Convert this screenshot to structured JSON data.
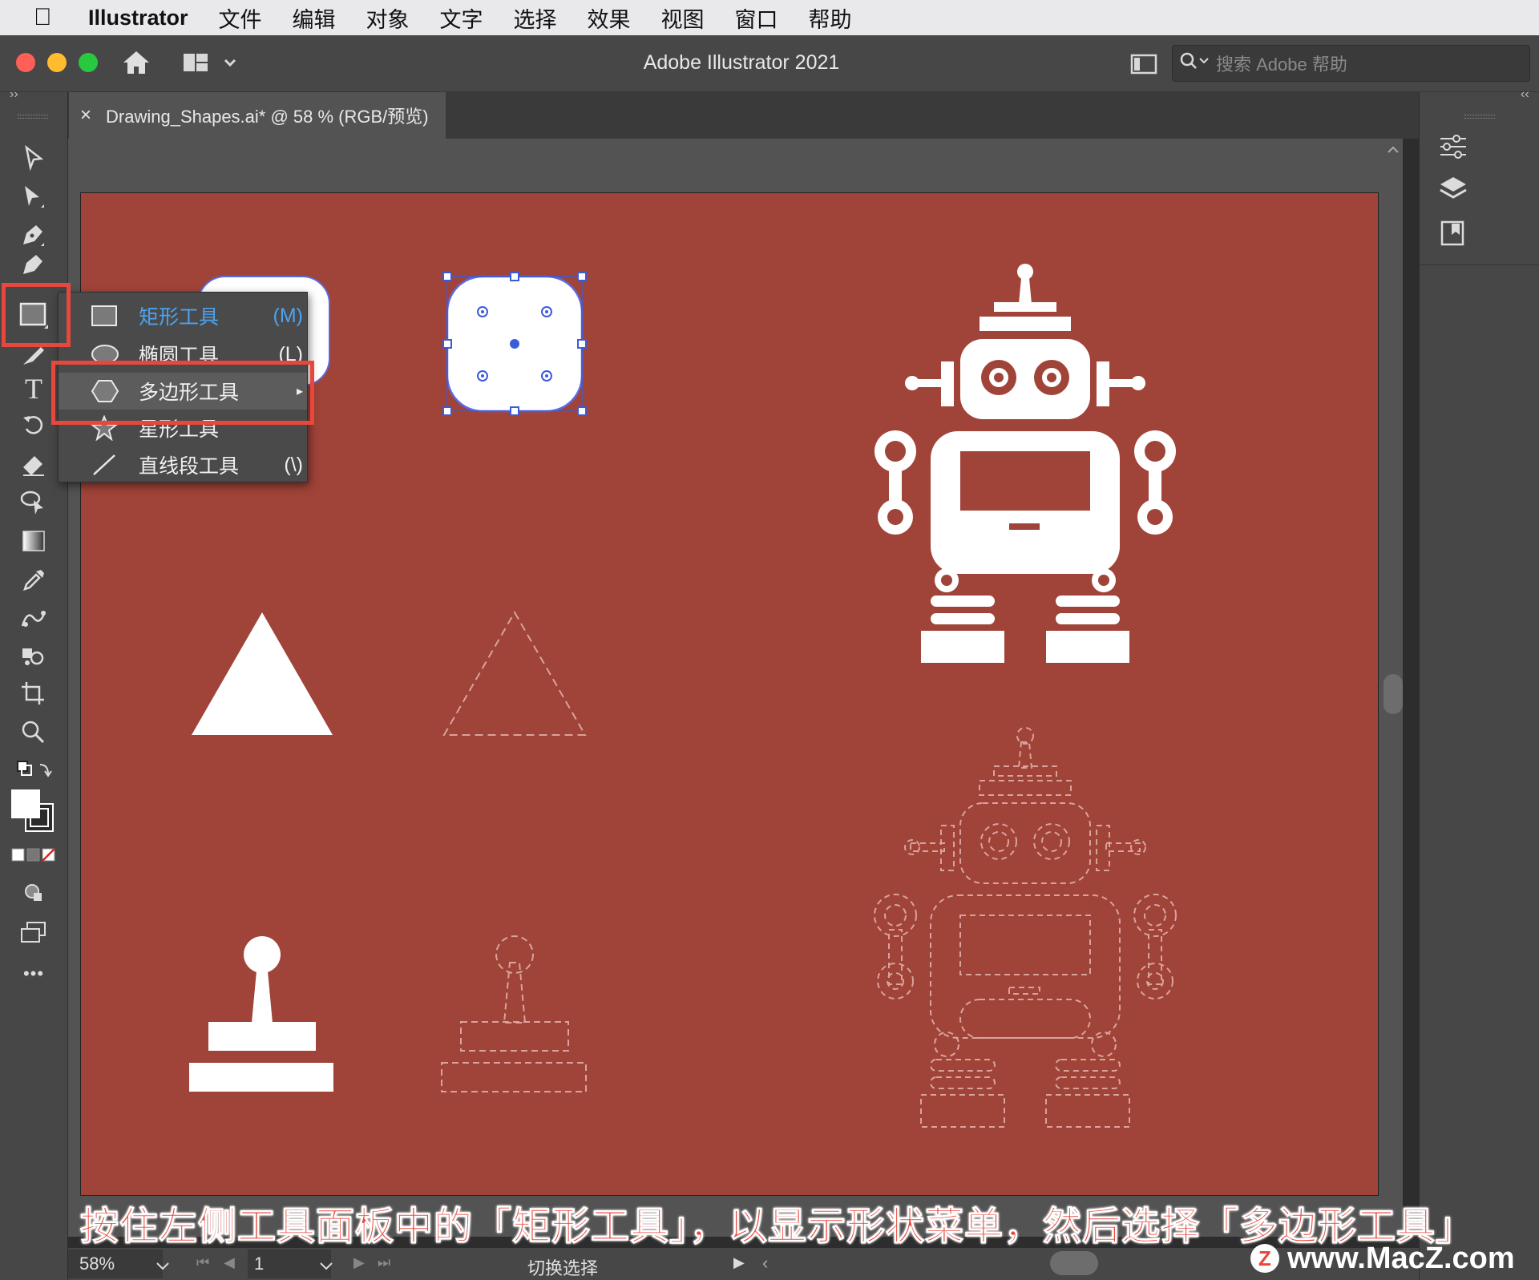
{
  "menubar": {
    "app_name": "Illustrator",
    "items": [
      "文件",
      "编辑",
      "对象",
      "文字",
      "选择",
      "效果",
      "视图",
      "窗口",
      "帮助"
    ]
  },
  "window": {
    "title": "Adobe Illustrator 2021",
    "help_search_placeholder": "搜索 Adobe 帮助",
    "traffic_colors": [
      "#fe5f57",
      "#febc2e",
      "#28c840"
    ]
  },
  "document_tab": {
    "close_glyph": "×",
    "label": "Drawing_Shapes.ai* @ 58 % (RGB/预览)"
  },
  "toolbar": {
    "tools": [
      "selection-tool-icon",
      "direct-selection-tool-icon",
      "pen-tool-icon",
      "curvature-tool-icon",
      "rectangle-tool-icon",
      "paintbrush-tool-icon",
      "type-tool-icon",
      "rotate-tool-icon",
      "eraser-tool-icon",
      "shape-builder-tool-icon",
      "gradient-tool-icon",
      "eyedropper-tool-icon",
      "blend-tool-icon",
      "symbol-sprayer-tool-icon",
      "artboard-tool-icon",
      "zoom-tool-icon"
    ],
    "more_glyph": "•••"
  },
  "flyout": {
    "items": [
      {
        "label": "矩形工具",
        "key": "(M)",
        "icon": "rectangle-icon",
        "active": true
      },
      {
        "label": "椭圆工具",
        "key": "(L)",
        "icon": "ellipse-icon",
        "active": false
      },
      {
        "label": "多边形工具",
        "key": "",
        "icon": "polygon-icon",
        "active": false,
        "highlighted": true
      },
      {
        "label": "星形工具",
        "key": "",
        "icon": "star-icon",
        "active": false
      },
      {
        "label": "直线段工具",
        "key": "(\\)",
        "icon": "line-segment-icon",
        "active": false
      }
    ],
    "accent": "#4ba3f0",
    "highlight": "#e8473b"
  },
  "artboard": {
    "background": "#a04339"
  },
  "statusbar": {
    "zoom": "58%",
    "page": "1",
    "selection_label": "切换选择"
  },
  "caption": "按住左侧工具面板中的「矩形工具」，以显示形状菜单，然后选择「多边形工具」",
  "watermark": "www.MacZ.com"
}
